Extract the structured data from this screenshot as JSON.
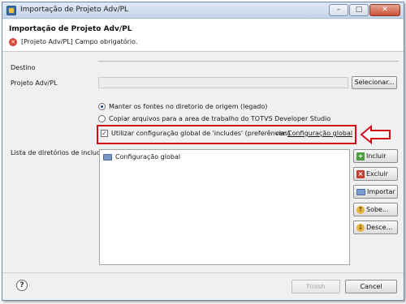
{
  "window": {
    "title": "Importação de Projeto Adv/PL",
    "min_glyph": "–",
    "max_glyph": "□",
    "close_glyph": "✕"
  },
  "header": {
    "heading": "Importação de Projeto Adv/PL",
    "error_glyph": "✕",
    "error_message": "[Projeto Adv/PL] Campo obrigatório."
  },
  "form": {
    "destino_label": "Destino",
    "projeto_label": "Projeto Adv/PL",
    "projeto_value": "",
    "selecionar_label": "Selecionar...",
    "radio_manter": "Manter os fontes no diretorio de origem (legado)",
    "radio_copiar": "Copiar arquivos para a area de trabalho do TOTVS Developer Studio",
    "checkbox_label": "Utilizar configuração global de 'includes' (preferências)",
    "checkbox_checked": true,
    "checkbox_glyph": "✓",
    "ver_text": "ver",
    "config_link": "Configuração global"
  },
  "includes": {
    "label": "Lista de diretórios de include",
    "items": [
      {
        "label": "Configuração global"
      }
    ],
    "buttons": {
      "incluir": "Incluir",
      "excluir": "Excluir",
      "importar": "Importar",
      "sobe": "Sobe...",
      "desce": "Desce..."
    }
  },
  "footer": {
    "help_glyph": "?",
    "finish_label": "Finish",
    "cancel_label": "Cancel"
  },
  "annotation": {
    "box_color": "#d10f1a",
    "arrow_color": "#d10f1a"
  }
}
